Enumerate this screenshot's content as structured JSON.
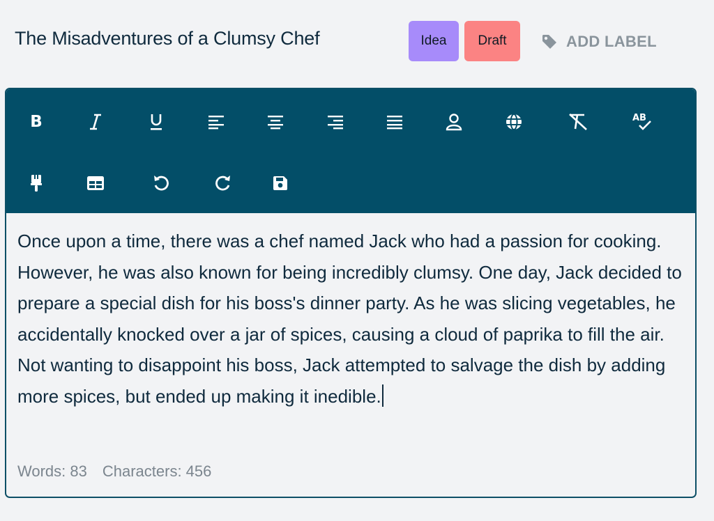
{
  "document": {
    "title": "The Misadventures of a Clumsy Chef"
  },
  "labels": [
    {
      "text": "Idea",
      "color": "#a78bfa"
    },
    {
      "text": "Draft",
      "color": "#fb8383"
    }
  ],
  "add_label": {
    "text": "ADD LABEL",
    "icon": "tag-icon"
  },
  "toolbar": {
    "background": "#034e68",
    "buttons": [
      {
        "name": "bold",
        "icon": "bold-icon"
      },
      {
        "name": "italic",
        "icon": "italic-icon"
      },
      {
        "name": "underline",
        "icon": "underline-icon"
      },
      {
        "name": "align-left",
        "icon": "align-left-icon"
      },
      {
        "name": "align-center",
        "icon": "align-center-icon"
      },
      {
        "name": "align-right",
        "icon": "align-right-icon"
      },
      {
        "name": "justify",
        "icon": "align-justify-icon"
      },
      {
        "name": "user",
        "icon": "user-icon"
      },
      {
        "name": "language",
        "icon": "globe-icon"
      },
      {
        "name": "clear-formatting",
        "icon": "clear-format-icon"
      },
      {
        "name": "spellcheck",
        "icon": "spellcheck-icon"
      },
      {
        "name": "format-painter",
        "icon": "paint-brush-icon"
      },
      {
        "name": "table",
        "icon": "table-icon"
      },
      {
        "name": "undo",
        "icon": "undo-icon"
      },
      {
        "name": "redo",
        "icon": "redo-icon"
      },
      {
        "name": "save",
        "icon": "save-icon"
      }
    ],
    "glyphs": {
      "bold": "B",
      "underline": "U"
    }
  },
  "editor": {
    "content": "Once upon a time, there was a chef named Jack who had a passion for cooking. However, he was also known for being incredibly clumsy. One day, Jack decided to prepare a special dish for his boss's dinner party. As he was slicing vegetables, he accidentally knocked over a jar of spices, causing a cloud of paprika to fill the air. Not wanting to disappoint his boss, Jack attempted to salvage the dish by adding more spices, but ended up making it inedible."
  },
  "stats": {
    "words": "Words: 83",
    "characters": "Characters: 456"
  }
}
